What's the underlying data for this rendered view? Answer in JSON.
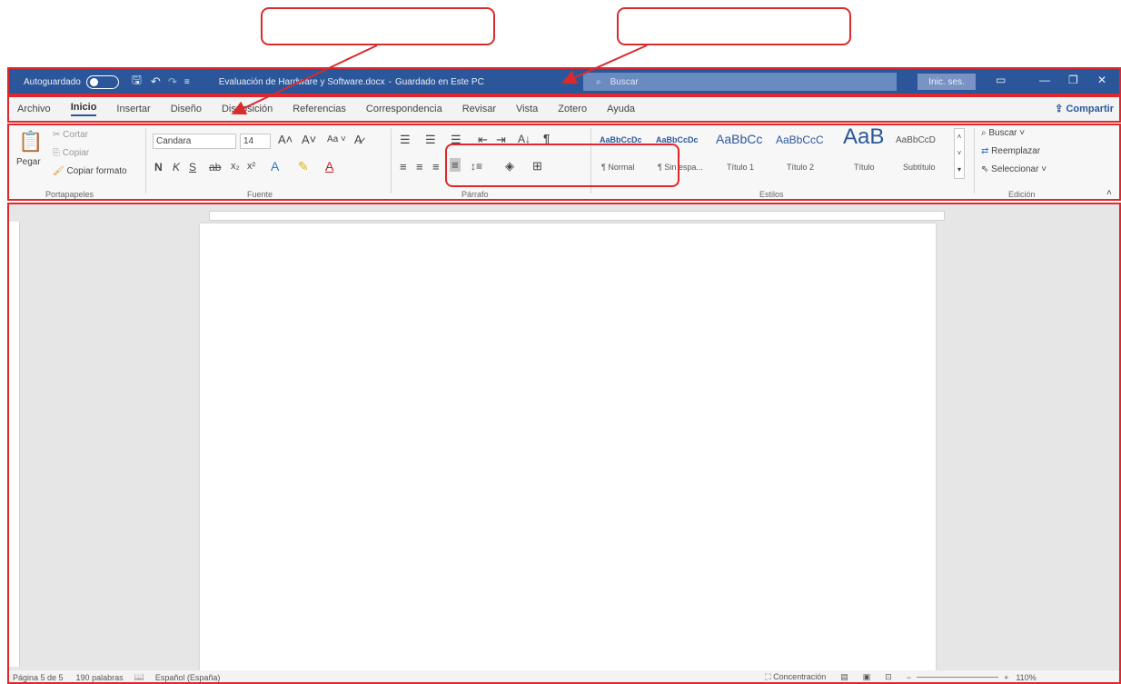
{
  "titlebar": {
    "autosave_label": "Autoguardado",
    "doc_title": "Evaluación de Hardware y Software.docx",
    "save_status": "Guardado en Este PC",
    "search_placeholder": "Buscar",
    "signin_label": "Inic. ses."
  },
  "tabs": [
    "Archivo",
    "Inicio",
    "Insertar",
    "Diseño",
    "Disposición",
    "Referencias",
    "Correspondencia",
    "Revisar",
    "Vista",
    "Zotero",
    "Ayuda"
  ],
  "share_label": "Compartir",
  "clipboard": {
    "paste": "Pegar",
    "cut": "Cortar",
    "copy": "Copiar",
    "format_painter": "Copiar formato",
    "group": "Portapapeles"
  },
  "font": {
    "name": "Candara",
    "size": "14",
    "group": "Fuente",
    "bold": "N",
    "italic": "K",
    "underline": "S"
  },
  "paragraph": {
    "group": "Párrafo"
  },
  "styles": {
    "group": "Estilos",
    "items": [
      {
        "preview": "AaBbCcDc",
        "name": "¶ Normal"
      },
      {
        "preview": "AaBbCcDc",
        "name": "¶ Sin espa..."
      },
      {
        "preview": "AaBbCc",
        "name": "Título 1"
      },
      {
        "preview": "AaBbCcC",
        "name": "Título 2"
      },
      {
        "preview": "AaB",
        "name": "Título"
      },
      {
        "preview": "AaBbCcD",
        "name": "Subtítulo"
      }
    ]
  },
  "editing": {
    "find": "Buscar",
    "replace": "Reemplazar",
    "select": "Seleccionar",
    "group": "Edición"
  },
  "statusbar": {
    "page": "Página 5 de 5",
    "words": "190 palabras",
    "language": "Español (España)",
    "focus": "Concentración",
    "zoom": "110%"
  },
  "colors": {
    "accent": "#2b579a",
    "callout": "#d92b2b"
  }
}
